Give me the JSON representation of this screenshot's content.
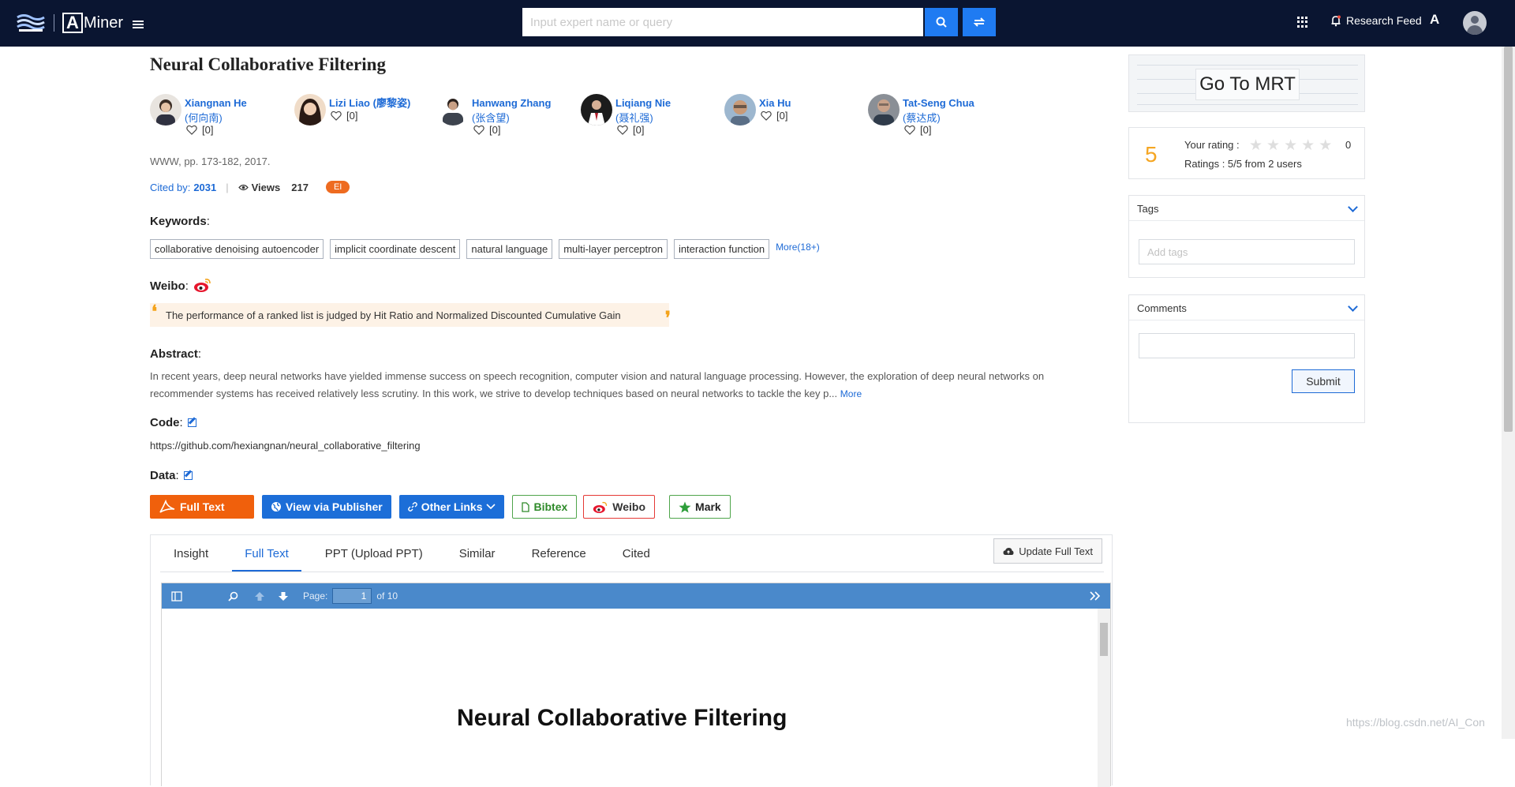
{
  "header": {
    "search_placeholder": "Input expert name or query",
    "research_feed_label": "Research Feed",
    "lang_icon_text": "A",
    "brand": "Miner",
    "brand_letter": "A"
  },
  "paper": {
    "title": "Neural Collaborative Filtering",
    "venue": "WWW, pp. 173-182, 2017.",
    "cited_label": "Cited by:",
    "cited_count": "2031",
    "views_label": "Views",
    "views_count": "217",
    "badge": "EI"
  },
  "authors": [
    {
      "name": "Xiangnan He",
      "native": "(何向南)",
      "likes": "[0]"
    },
    {
      "name": "Lizi Liao (廖黎姿)",
      "native": "",
      "likes": "[0]"
    },
    {
      "name": "Hanwang Zhang",
      "native": "(张含望)",
      "likes": "[0]"
    },
    {
      "name": "Liqiang Nie",
      "native": "(聂礼强)",
      "likes": "[0]"
    },
    {
      "name": "Xia Hu",
      "native": "",
      "likes": "[0]"
    },
    {
      "name": "Tat-Seng Chua",
      "native": "(蔡达成)",
      "likes": "[0]"
    }
  ],
  "keywords": {
    "label": "Keywords",
    "items": [
      "collaborative denoising autoencoder",
      "implicit coordinate descent",
      "natural language",
      "multi-layer perceptron",
      "interaction function"
    ],
    "more": "More(18+)"
  },
  "weibo": {
    "label": "Weibo",
    "quote": "The performance of a ranked list is judged by Hit Ratio and Normalized Discounted Cumulative Gain"
  },
  "abstract": {
    "label": "Abstract",
    "text": "In recent years, deep neural networks have yielded immense success on speech recognition, computer vision and natural language processing. However, the exploration of deep neural networks on recommender systems has received relatively less scrutiny. In this work, we strive to develop techniques based on neural networks to tackle the key p...",
    "more": "More"
  },
  "code": {
    "label": "Code",
    "url": "https://github.com/hexiangnan/neural_collaborative_filtering"
  },
  "data_section": {
    "label": "Data"
  },
  "actions": {
    "full_text": "Full Text",
    "view_publisher": "View via Publisher",
    "other_links": "Other Links",
    "bibtex": "Bibtex",
    "weibo": "Weibo",
    "mark": "Mark"
  },
  "tabs": {
    "items": [
      "Insight",
      "Full Text",
      "PPT (Upload PPT)",
      "Similar",
      "Reference",
      "Cited"
    ],
    "active": "Full Text",
    "update_button": "Update Full Text"
  },
  "pdf": {
    "page_label": "Page:",
    "page_value": "1",
    "page_total": "of 10",
    "doc_title": "Neural Collaborative Filtering"
  },
  "sidebar": {
    "mrt_button": "Go To MRT",
    "rating_score": "5",
    "your_rating_label": "Your rating :",
    "your_rating_value": 0,
    "your_rating_count": "0",
    "ratings_summary": "Ratings : 5/5 from 2 users",
    "tags_title": "Tags",
    "tags_placeholder": "Add tags",
    "comments_title": "Comments",
    "submit_label": "Submit"
  },
  "watermark": "https://blog.csdn.net/AI_Con",
  "colors": {
    "nav_bg": "#0a1531",
    "link_blue": "#1d6ad6",
    "full_text_orange": "#f0600c",
    "publisher_blue": "#1c6ed8",
    "rating_orange": "#f5a623",
    "pdf_toolbar": "#4a89cb"
  }
}
